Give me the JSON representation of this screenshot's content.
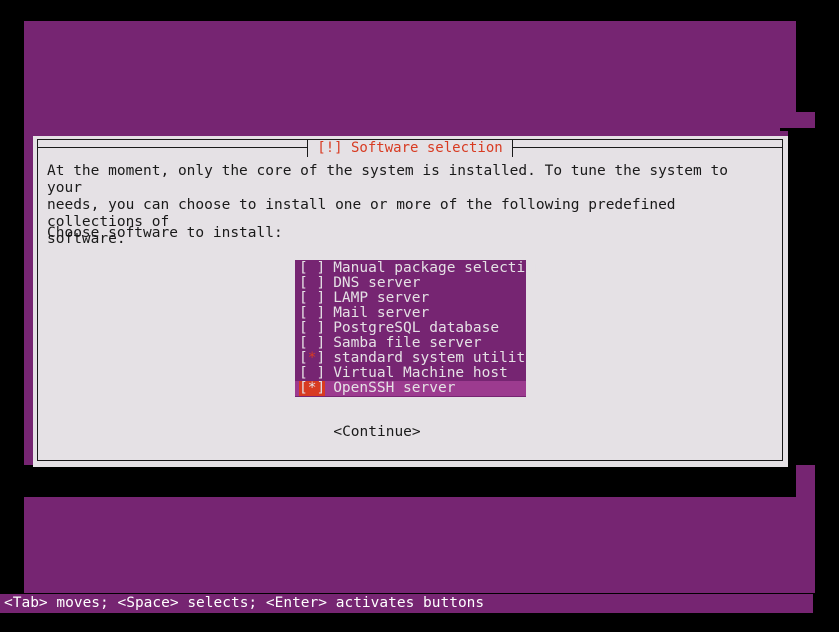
{
  "screen": {
    "background_color": "#000000",
    "backdrop_color": "#762572",
    "dialog_background_color": "#e5e1e5",
    "accent_color": "#d83b22",
    "selection_color": "#9c3b8f"
  },
  "dialog": {
    "title": "[!] Software selection",
    "body": "At the moment, only the core of the system is installed. To tune the system to your\nneeds, you can choose to install one or more of the following predefined collections of\nsoftware.",
    "prompt": "Choose software to install:"
  },
  "software_list": [
    {
      "checkbox": "[ ]",
      "checked": false,
      "label": "Manual package selection",
      "selected": false
    },
    {
      "checkbox": "[ ]",
      "checked": false,
      "label": "DNS server",
      "selected": false
    },
    {
      "checkbox": "[ ]",
      "checked": false,
      "label": "LAMP server",
      "selected": false
    },
    {
      "checkbox": "[ ]",
      "checked": false,
      "label": "Mail server",
      "selected": false
    },
    {
      "checkbox": "[ ]",
      "checked": false,
      "label": "PostgreSQL database",
      "selected": false
    },
    {
      "checkbox": "[ ]",
      "checked": false,
      "label": "Samba file server",
      "selected": false
    },
    {
      "checkbox": "[*]",
      "checked": true,
      "label": "standard system utilities",
      "selected": false
    },
    {
      "checkbox": "[ ]",
      "checked": false,
      "label": "Virtual Machine host",
      "selected": false
    },
    {
      "checkbox": "[*]",
      "checked": true,
      "label": "OpenSSH server",
      "selected": true
    }
  ],
  "buttons": {
    "continue": "<Continue>"
  },
  "statusbar": {
    "hint": "<Tab> moves; <Space> selects; <Enter> activates buttons"
  }
}
